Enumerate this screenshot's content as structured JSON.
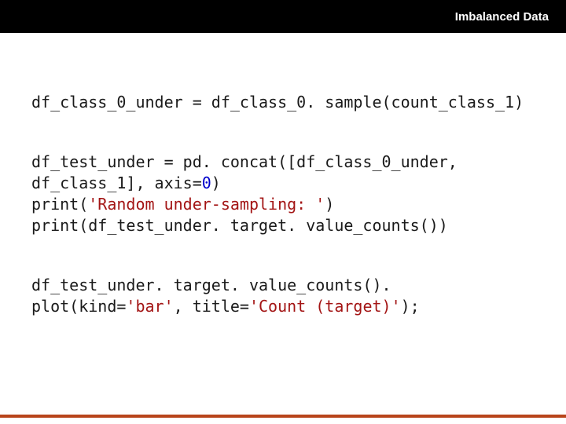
{
  "header": {
    "title": "Imbalanced Data"
  },
  "code": {
    "l1_a": "df_class_0_under = df_class_0. sample(count_class_1)",
    "l2_a": "df_test_under = pd. concat([df_class_0_under, df_class_1], axis=",
    "l2_num": "0",
    "l2_b": ")",
    "l3_a": "print(",
    "l3_str": "'Random under-sampling: '",
    "l3_b": ")",
    "l4_a": "print(df_test_under. target. value_counts())",
    "l5_a": "df_test_under. target. value_counts(). plot(kind=",
    "l5_str1": "'bar'",
    "l5_b": ", title=",
    "l5_str2": "'Count (target)'",
    "l5_c": ");"
  }
}
